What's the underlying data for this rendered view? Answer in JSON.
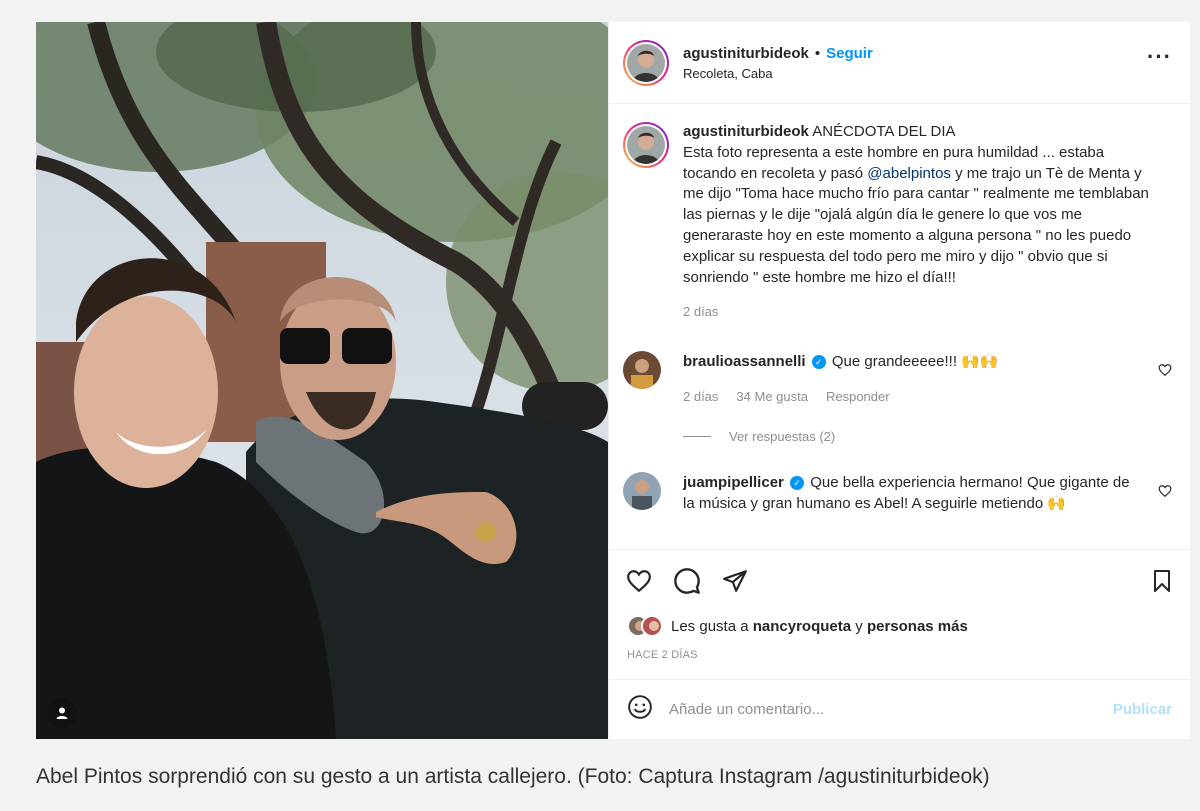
{
  "header": {
    "username": "agustiniturbideok",
    "separator": "•",
    "follow_label": "Seguir",
    "location": "Recoleta, Caba",
    "more_icon": "more-horizontal-icon"
  },
  "caption": {
    "username": "agustiniturbideok",
    "title": "ANÉCDOTA DEL DIA",
    "text_before_mention": "Esta foto representa a este hombre en pura humildad ... estaba tocando en recoleta y pasó",
    "mention": "@abelpintos",
    "text_after_mention": "y me trajo un Tè de Menta y me dijo \"Toma hace mucho frío para cantar \" realmente me temblaban las piernas y le dije \"ojalá algún día le genere lo que vos me generaraste hoy en este momento a alguna persona \" no les puedo explicar su respuesta del todo pero me miro y dijo \" obvio que si sonriendo \" este hombre me hizo el día!!!",
    "time": "2 días"
  },
  "comments": [
    {
      "username": "braulioassannelli",
      "verified": true,
      "text": "Que grandeeeee!!! 🙌🙌",
      "time": "2 días",
      "likes": "34 Me gusta",
      "reply_label": "Responder",
      "view_replies": "Ver respuestas (2)"
    },
    {
      "username": "juampipellicer",
      "verified": true,
      "text": "Que bella experiencia hermano! Que gigante de la música y gran humano es Abel! A seguirle metiendo 🙌"
    }
  ],
  "likes": {
    "prefix": "Les gusta a",
    "user": "nancyroqueta",
    "connector": "y",
    "others": "personas más"
  },
  "posted_ago": "HACE 2 DÍAS",
  "add_comment": {
    "placeholder": "Añade un comentario...",
    "publish_label": "Publicar"
  },
  "image_caption": "Abel Pintos sorprendió con su gesto a un artista callejero. (Foto: Captura Instagram /agustiniturbideok)",
  "colors": {
    "link_blue": "#0095f6",
    "mention_blue": "#00376b",
    "muted": "#8e8e8e",
    "publish_disabled": "#b2dffc"
  }
}
